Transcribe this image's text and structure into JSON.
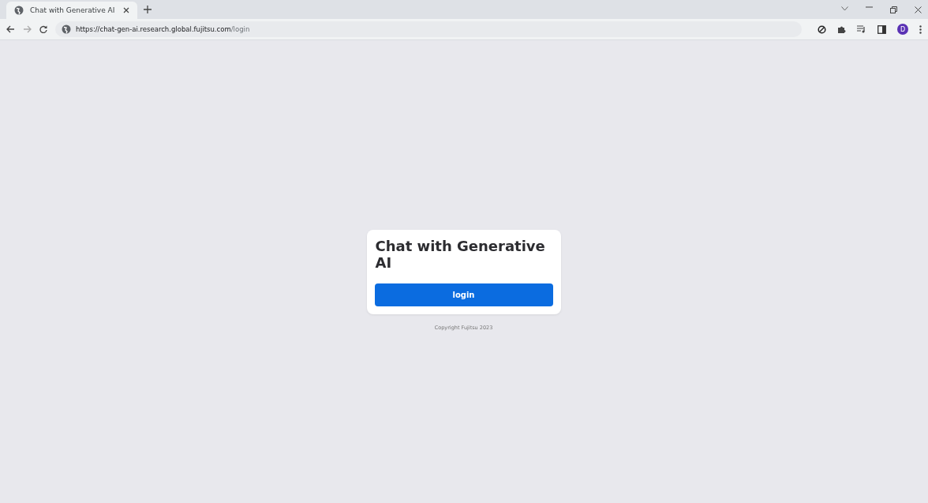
{
  "browser": {
    "tabs": [
      {
        "title": "Chat with Generative AI",
        "selected": true
      }
    ],
    "url_host": "https://chat-gen-ai.research.global.fujitsu.com",
    "url_path": "/login",
    "profile_initial": "D"
  },
  "card": {
    "title": "Chat with Generative AI",
    "button": "login"
  },
  "footer": "Copyright Fujitsu 2023"
}
